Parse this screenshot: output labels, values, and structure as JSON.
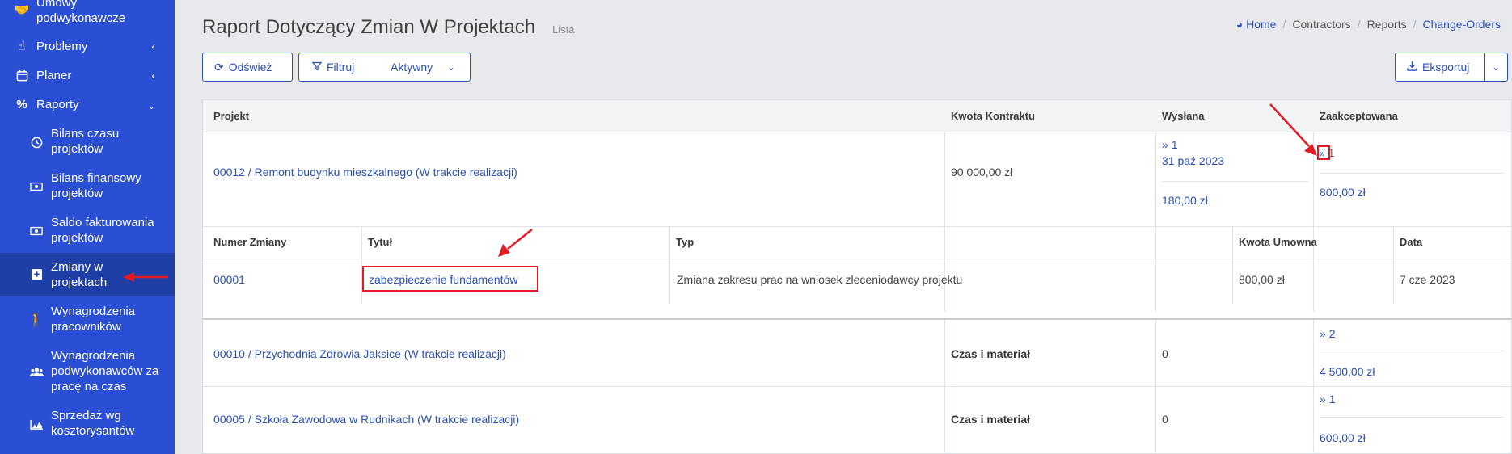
{
  "sidebar": {
    "items": [
      {
        "label": "Umowy podwykonawcze",
        "icon": "handshake-icon"
      },
      {
        "label": "Problemy",
        "icon": "hand-pointer-icon"
      },
      {
        "label": "Planer",
        "icon": "calendar-icon"
      },
      {
        "label": "Raporty",
        "icon": "percent-icon"
      }
    ],
    "sub": [
      {
        "label": "Bilans czasu projektów",
        "icon": "clock-icon"
      },
      {
        "label": "Bilans finansowy projektów",
        "icon": "money-icon"
      },
      {
        "label": "Saldo fakturowania projektów",
        "icon": "money-icon"
      },
      {
        "label": "Zmiany w projektach",
        "icon": "plus-square-icon"
      },
      {
        "label": "Wynagrodzenia pracowników",
        "icon": "child-icon"
      },
      {
        "label": "Wynagrodzenia podwykonawców za pracę na czas",
        "icon": "users-icon"
      },
      {
        "label": "Sprzedaż wg kosztorysantów",
        "icon": "area-chart-icon"
      }
    ]
  },
  "header": {
    "title": "Raport Dotyczący Zmian W Projektach",
    "subtitle": "Lista",
    "breadcrumb": [
      "Home",
      "Contractors",
      "Reports",
      "Change-Orders"
    ]
  },
  "toolbar": {
    "refresh": "Odśwież",
    "filter": "Filtruj",
    "filter_value": "Aktywny",
    "export": "Eksportuj"
  },
  "table": {
    "headers": [
      "Projekt",
      "Kwota Kontraktu",
      "Wysłana",
      "Zaakceptowana"
    ],
    "rows": [
      {
        "project": "00012 / Remont budynku mieszkalnego (W trakcie realizacji)",
        "amount": "90 000,00 zł",
        "sent_count": "1",
        "sent_date": "31 paź 2023",
        "sent_value": "180,00 zł",
        "acc_count": "1",
        "acc_value": "800,00 zł"
      },
      {
        "project": "00010 / Przychodnia Zdrowia Jaksice (W trakcie realizacji)",
        "amount": "Czas i materiał",
        "sent": "0",
        "acc_count": "2",
        "acc_value": "4 500,00 zł"
      },
      {
        "project": "00005 / Szkoła Zawodowa w Rudnikach (W trakcie realizacji)",
        "amount": "Czas i materiał",
        "sent": "0",
        "acc_count": "1",
        "acc_value": "600,00 zł"
      }
    ],
    "detail": {
      "headers": [
        "Numer Zmiany",
        "Tytuł",
        "Typ",
        "Kwota Umowna",
        "Data"
      ],
      "row": {
        "number": "00001",
        "title": "zabezpieczenie fundamentów",
        "type": "Zmiana zakresu prac na wniosek zleceniodawcy projektu",
        "amount": "800,00 zł",
        "date": "7 cze 2023"
      }
    }
  },
  "colors": {
    "sidebar": "#2b4fd4",
    "accent": "#2b4fb8",
    "highlight": "#e31b23"
  }
}
